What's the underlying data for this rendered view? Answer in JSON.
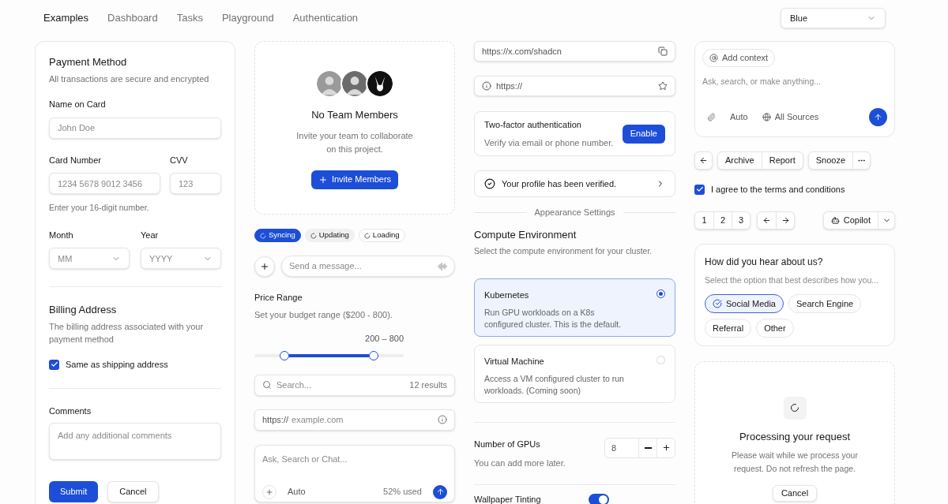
{
  "nav": {
    "tabs": [
      {
        "label": "Examples",
        "selected": true
      },
      {
        "label": "Dashboard",
        "selected": false
      },
      {
        "label": "Tasks",
        "selected": false
      },
      {
        "label": "Playground",
        "selected": false
      },
      {
        "label": "Authentication",
        "selected": false
      }
    ],
    "theme_select": {
      "value": "Blue"
    }
  },
  "payment": {
    "title": "Payment Method",
    "description": "All transactions are secure and encrypted",
    "name_label": "Name on Card",
    "name_placeholder": "John Doe",
    "card_label": "Card Number",
    "card_placeholder": "1234 5678 9012 3456",
    "cvv_label": "CVV",
    "cvv_placeholder": "123",
    "card_hint": "Enter your 16-digit number.",
    "month_label": "Month",
    "month_placeholder": "MM",
    "year_label": "Year",
    "year_placeholder": "YYYY",
    "billing_title": "Billing Address",
    "billing_description": "The billing address associated with your payment method",
    "same_address": {
      "label": "Same as shipping address",
      "checked": true
    },
    "comments_label": "Comments",
    "comments_placeholder": "Add any additional comments",
    "buttons": [
      {
        "label": "Submit",
        "kind": "primary"
      },
      {
        "label": "Cancel",
        "kind": "outline"
      }
    ]
  },
  "team": {
    "title": "No Team Members",
    "description": "Invite your team to collaborate on this project.",
    "button": "Invite Members"
  },
  "badges": [
    {
      "label": "Syncing",
      "kind": "primary"
    },
    {
      "label": "Updating",
      "kind": "secondary"
    },
    {
      "label": "Loading",
      "kind": "outline"
    }
  ],
  "message": {
    "placeholder": "Send a message..."
  },
  "price": {
    "label": "Price Range",
    "description": "Set your budget range ($200 - 800).",
    "reading": "200 – 800",
    "thumbs": [
      {
        "level": 0.2
      },
      {
        "level": 0.8
      }
    ]
  },
  "search": {
    "placeholder": "Search...",
    "count": "12 results"
  },
  "url": {
    "prefix": "https://",
    "placeholder": "example.com"
  },
  "chat": {
    "placeholder": "Ask, Search or Chat...",
    "mode": "Auto",
    "usage": "52% used"
  },
  "share_url": {
    "value": "https://x.com/shadcn"
  },
  "link_input": {
    "prefix": "https://"
  },
  "two_factor": {
    "title": "Two-factor authentication",
    "description": "Verify via email or phone number.",
    "button": "Enable"
  },
  "verified": {
    "text": "Your profile has been verified."
  },
  "appearance_divider": "Appearance Settings",
  "compute": {
    "title": "Compute Environment",
    "description": "Select the compute environment for your cluster.",
    "options": [
      {
        "title": "Kubernetes",
        "description": "Run GPU workloads on a K8s configured cluster. This is the default.",
        "selected": true
      },
      {
        "title": "Virtual Machine",
        "description": "Access a VM configured cluster to run workloads. (Coming soon)",
        "selected": false
      }
    ]
  },
  "gpus": {
    "label": "Number of GPUs",
    "description": "You can add more later.",
    "value": "8"
  },
  "wallpaper": {
    "label": "Wallpaper Tinting",
    "on": true
  },
  "prompt": {
    "context_chip": "Add context",
    "placeholder": "Ask, search, or make anything...",
    "mode": "Auto",
    "sources": "All Sources"
  },
  "actions": {
    "group_1": [
      "Archive",
      "Report"
    ],
    "group_2": [
      "Snooze"
    ]
  },
  "terms": {
    "label": "I agree to the terms and conditions",
    "checked": true
  },
  "pages": [
    {
      "label": "1"
    },
    {
      "label": "2"
    },
    {
      "label": "3"
    }
  ],
  "copilot": "Copilot",
  "survey": {
    "title": "How did you hear about us?",
    "description": "Select the option that best describes how you...",
    "options": [
      {
        "label": "Social Media",
        "selected": true
      },
      {
        "label": "Search Engine",
        "selected": false
      },
      {
        "label": "Referral",
        "selected": false
      },
      {
        "label": "Other",
        "selected": false
      }
    ]
  },
  "processing": {
    "title": "Processing your request",
    "description": "Please wait while we process your request. Do not refresh the page.",
    "button": "Cancel"
  }
}
